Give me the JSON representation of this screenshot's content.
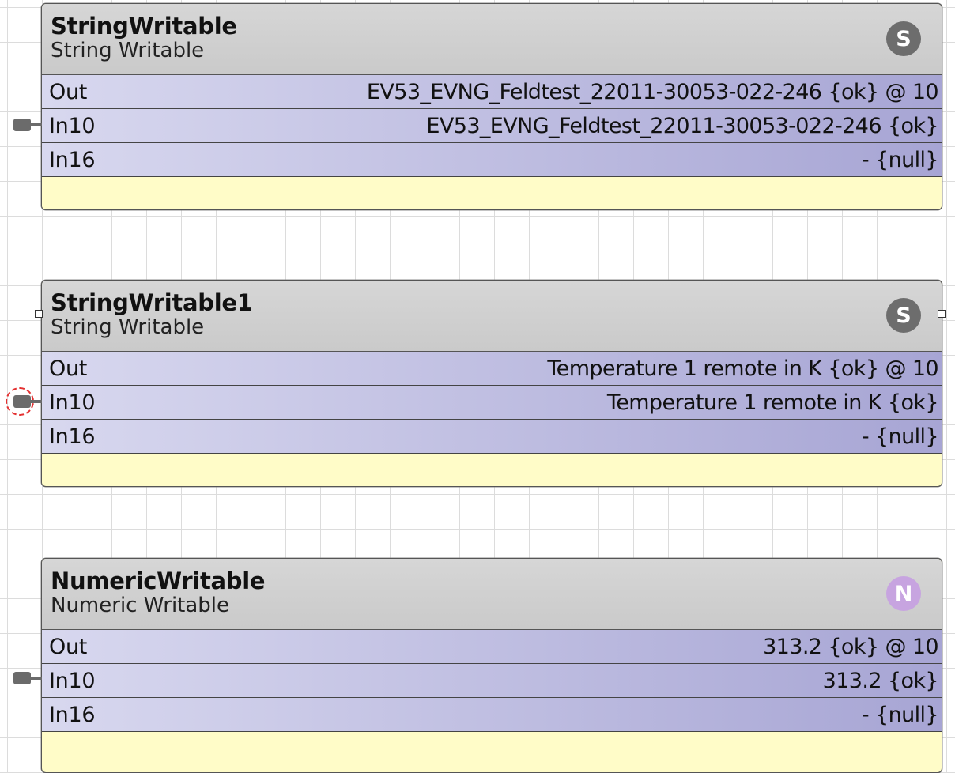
{
  "blocks": [
    {
      "title": "StringWritable",
      "subtitle": "String Writable",
      "icon": {
        "name": "string-type-icon",
        "glyph": "S",
        "color": "#6d6d6d"
      },
      "rows": [
        {
          "label": "Out",
          "value": "EV53_EVNG_Feldtest_22011-30053-022-246 {ok} @ 10"
        },
        {
          "label": "In10",
          "value": "EV53_EVNG_Feldtest_22011-30053-022-246 {ok}"
        },
        {
          "label": "In16",
          "value": "- {null}"
        }
      ]
    },
    {
      "title": "StringWritable1",
      "subtitle": "String Writable",
      "icon": {
        "name": "string-type-icon",
        "glyph": "S",
        "color": "#6d6d6d"
      },
      "rows": [
        {
          "label": "Out",
          "value": "Temperature 1 remote in K {ok} @ 10"
        },
        {
          "label": "In10",
          "value": "Temperature 1 remote in K {ok}"
        },
        {
          "label": "In16",
          "value": "- {null}"
        }
      ]
    },
    {
      "title": "NumericWritable",
      "subtitle": "Numeric Writable",
      "icon": {
        "name": "numeric-type-icon",
        "glyph": "N",
        "color": "#c7a4e0"
      },
      "rows": [
        {
          "label": "Out",
          "value": "313.2 {ok} @ 10"
        },
        {
          "label": "In10",
          "value": "313.2 {ok}"
        },
        {
          "label": "In16",
          "value": "- {null}"
        }
      ]
    }
  ],
  "colors": {
    "header_bg": "#cacaca",
    "row_gradient_start": "#d8d8ef",
    "row_gradient_end": "#a7a5d4",
    "footer_bg": "#fffcc8",
    "port_color": "#6b6b6b",
    "selection_ring": "#e43030"
  }
}
